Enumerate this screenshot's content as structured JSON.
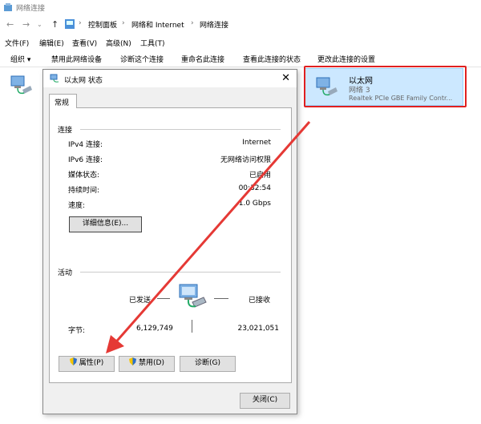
{
  "window": {
    "title": "网络连接"
  },
  "address": {
    "crumbs": [
      "控制面板",
      "网络和 Internet",
      "网络连接"
    ]
  },
  "menu": [
    "文件(F)",
    "编辑(E)",
    "查看(V)",
    "高级(N)",
    "工具(T)"
  ],
  "commands": {
    "organize": "组织 ▾",
    "items": [
      "禁用此网络设备",
      "诊断这个连接",
      "重命名此连接",
      "查看此连接的状态",
      "更改此连接的设置"
    ]
  },
  "adapter": {
    "name": "以太网",
    "network": "网络 3",
    "device": "Realtek PCIe GBE Family Contr..."
  },
  "dialog": {
    "title": "以太网 状态",
    "close": "✕",
    "tab": "常规",
    "connection": {
      "header": "连接",
      "rows": [
        {
          "label": "IPv4 连接:",
          "value": "Internet"
        },
        {
          "label": "IPv6 连接:",
          "value": "无网络访问权限"
        },
        {
          "label": "媒体状态:",
          "value": "已启用"
        },
        {
          "label": "持续时间:",
          "value": "00:32:54"
        },
        {
          "label": "速度:",
          "value": "1.0 Gbps"
        }
      ],
      "details_button": "详细信息(E)..."
    },
    "activity": {
      "header": "活动",
      "sent": "已发送",
      "received": "已接收",
      "bytes_label": "字节:",
      "bytes_sent": "6,129,749",
      "bytes_received": "23,021,051"
    },
    "buttons": {
      "properties": "属性(P)",
      "disable": "禁用(D)",
      "diagnose": "诊断(G)",
      "close": "关闭(C)"
    }
  },
  "accent": {
    "arrow": "#e53935",
    "highlight": "#cce8ff"
  }
}
